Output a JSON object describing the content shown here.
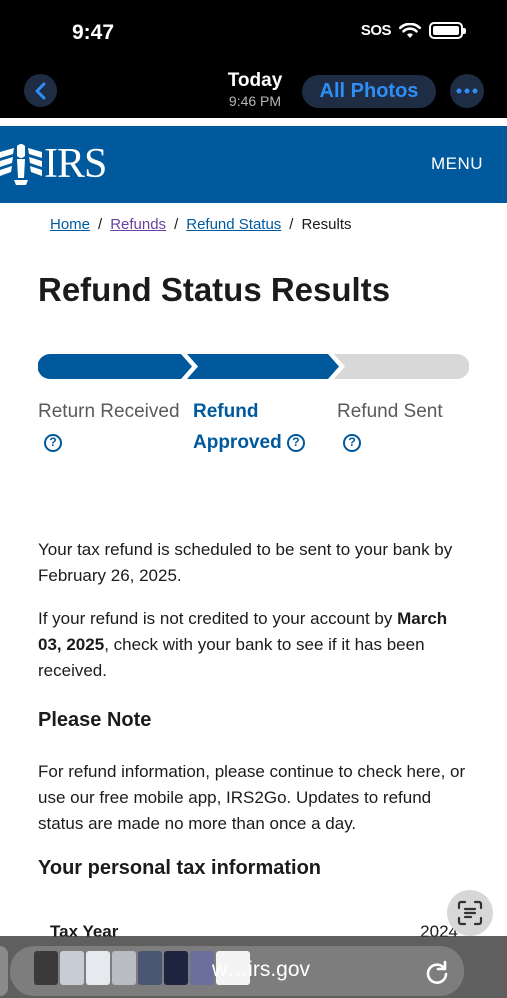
{
  "status_bar": {
    "time": "9:47",
    "signal": "SOS"
  },
  "photos_nav": {
    "title": "Today",
    "subtitle": "9:46 PM",
    "all_photos_label": "All Photos"
  },
  "irs_header": {
    "logo_text": "IRS",
    "menu_label": "MENU",
    "brand_color": "#00599c"
  },
  "breadcrumb": [
    {
      "label": "Home"
    },
    {
      "label": "Refunds"
    },
    {
      "label": "Refund Status"
    },
    {
      "label": "Results"
    }
  ],
  "page_title": "Refund Status Results",
  "tracker": {
    "steps": [
      {
        "line1": "Return Received",
        "line2": "",
        "state": "complete"
      },
      {
        "line1": "Refund",
        "line2": "Approved",
        "state": "current"
      },
      {
        "line1": "Refund Sent",
        "line2": "",
        "state": "pending"
      }
    ],
    "help_glyph": "?"
  },
  "content": {
    "para1": "Your tax refund is scheduled to be sent to your bank by February 26, 2025.",
    "para2_pre": "If your refund is not credited to your account by ",
    "para2_bold": "March 03, 2025",
    "para2_post": ", check with your bank to see if it has been received.",
    "note_heading": "Please Note",
    "note_text": "For refund information, please continue to check here, or use our free mobile app, IRS2Go. Updates to refund status are made no more than once a day.",
    "personal_heading": "Your personal tax information",
    "table": {
      "label": "Tax Year",
      "value": "2024"
    }
  },
  "browser": {
    "url": "www.irs.gov",
    "url_visible": "w…irs.gov"
  }
}
